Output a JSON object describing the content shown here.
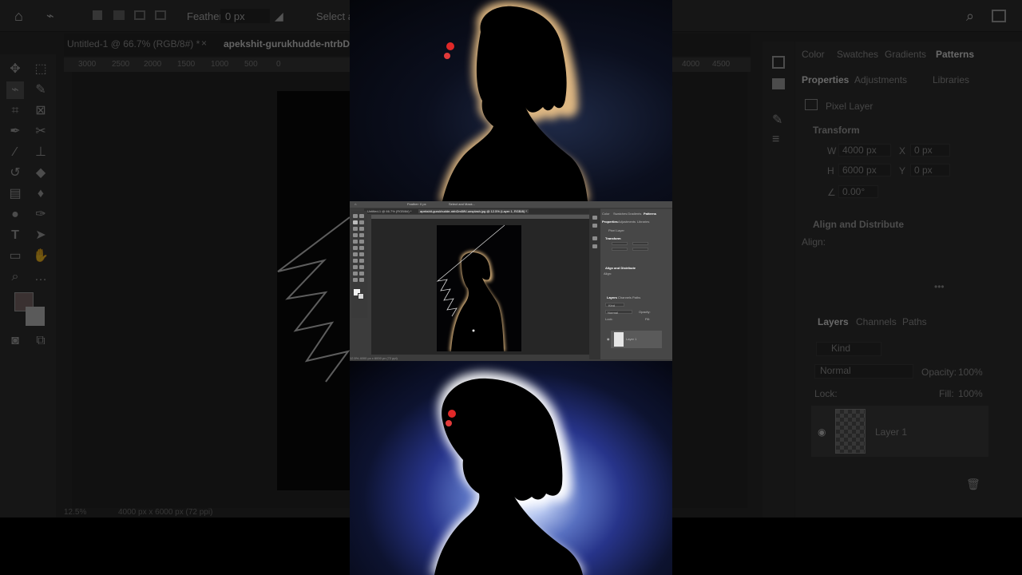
{
  "background_app": {
    "options_bar": {
      "feather_label": "Feather:",
      "feather_value": "0 px",
      "select_mask_label": "Select an"
    },
    "tabs": [
      {
        "label": "Untitled-1 @ 66.7% (RGB/8#) *"
      },
      {
        "label": "apekshit-gurukhudde-ntrbDm"
      }
    ],
    "ruler_ticks": [
      "3000",
      "2500",
      "2000",
      "1500",
      "1000",
      "500",
      "0",
      "4000",
      "4500"
    ],
    "status": {
      "zoom": "12.5%",
      "doc_size": "4000 px x 6000 px (72 ppi)"
    },
    "panels": {
      "top_tabs": [
        "Color",
        "Swatches",
        "Gradients",
        "Patterns"
      ],
      "prop_tabs": [
        "Properties",
        "Adjustments",
        "Libraries"
      ],
      "pixel_layer_label": "Pixel Layer",
      "transform_heading": "Transform",
      "fields": {
        "w_label": "W",
        "w_value": "4000 px",
        "x_label": "X",
        "x_value": "0 px",
        "h_label": "H",
        "h_value": "6000 px",
        "y_label": "Y",
        "y_value": "0 px",
        "angle_value": "0.00°"
      },
      "align_heading": "Align and Distribute",
      "align_label": "Align:",
      "layer_tabs": [
        "Layers",
        "Channels",
        "Paths"
      ],
      "kind_label": "Kind",
      "blend_mode": "Normal",
      "opacity_label": "Opacity:",
      "opacity_value": "100%",
      "lock_label": "Lock:",
      "fill_label": "Fill:",
      "fill_value": "100%",
      "layer_name": "Layer 1",
      "more_label": "•••"
    }
  },
  "inset_app": {
    "options_bar": {
      "feather": "Feather: 0 px",
      "select_mask": "Select and Mask..."
    },
    "tabs": [
      {
        "label": "Untitled-1 @ 66.7% (RGB/8#) *"
      },
      {
        "label": "apekshit-gurukhudde-ntrbDm5ifV-unsplash.jpg @ 12.5% (Layer 1, RGB/8) *"
      }
    ],
    "status": "12.5%   4000 px x 6000 px (72 ppi)",
    "panel_top_tabs": [
      "Color",
      "Swatches",
      "Gradients",
      "Patterns"
    ],
    "prop_tabs": [
      "Properties",
      "Adjustments",
      "Libraries"
    ],
    "pixel_layer": "Pixel Layer",
    "transform": "Transform",
    "align": "Align and Distribute",
    "align_sub": "Align:",
    "layer_tabs": [
      "Layers",
      "Channels",
      "Paths"
    ],
    "kind": "Kind",
    "normal": "Normal",
    "opacity": "Opacity:",
    "lock": "Lock:",
    "fill": "Fill:",
    "layer_name": "Layer 1"
  },
  "colors": {
    "ps_panel": "#323232",
    "ps_canvas": "#262626",
    "rim_light": "#f3c78a",
    "backlight": "#b8c8f0"
  },
  "icons": {
    "home": "home-icon",
    "lasso": "polygonal-lasso-icon",
    "search": "search-icon",
    "eye": "eye-icon",
    "trash": "trash-icon"
  }
}
